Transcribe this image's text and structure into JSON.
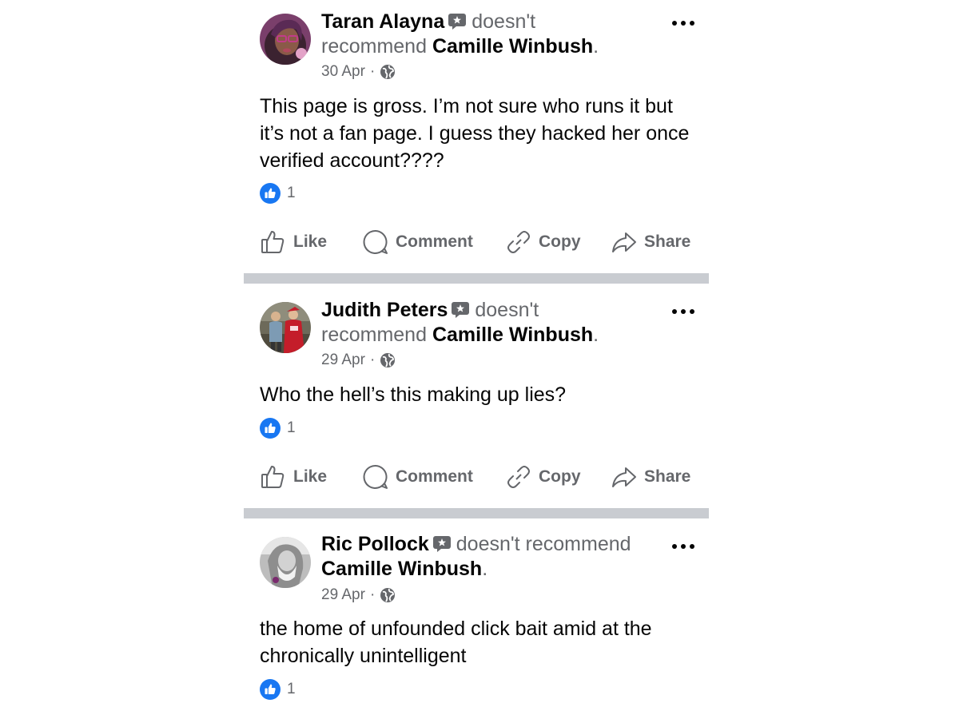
{
  "recommend_word": "doesn't recommend",
  "actions": {
    "like_label": "Like",
    "comment_label": "Comment",
    "copy_label": "Copy",
    "share_label": "Share"
  },
  "separator": "·",
  "colors": {
    "like_blue": "#1877f2",
    "secondary_text": "#65676b",
    "divider": "#c9ccd1"
  },
  "posts": [
    {
      "author": "Taran Alayna",
      "verb_part1": "doesn't",
      "verb_part2": "recommend",
      "page": "Camille Winbush",
      "date": "30 Apr",
      "audience_icon": "globe-icon",
      "text": "This page is gross. I’m not sure who runs it but it’s not a fan page. I guess they hacked her once verified account????",
      "reaction_count": "1"
    },
    {
      "author": "Judith Peters",
      "verb_part1": "doesn't",
      "verb_part2": "recommend",
      "page": "Camille Winbush",
      "date": "29 Apr",
      "audience_icon": "globe-icon",
      "text": "Who the hell’s this making up lies?",
      "reaction_count": "1"
    },
    {
      "author": "Ric Pollock",
      "verb_part1": "doesn't recommend",
      "verb_part2": "",
      "page": "Camille Winbush",
      "date": "29 Apr",
      "audience_icon": "globe-icon",
      "text": "the home of unfounded click bait amid at the chronically unintelligent",
      "reaction_count": "1"
    }
  ]
}
